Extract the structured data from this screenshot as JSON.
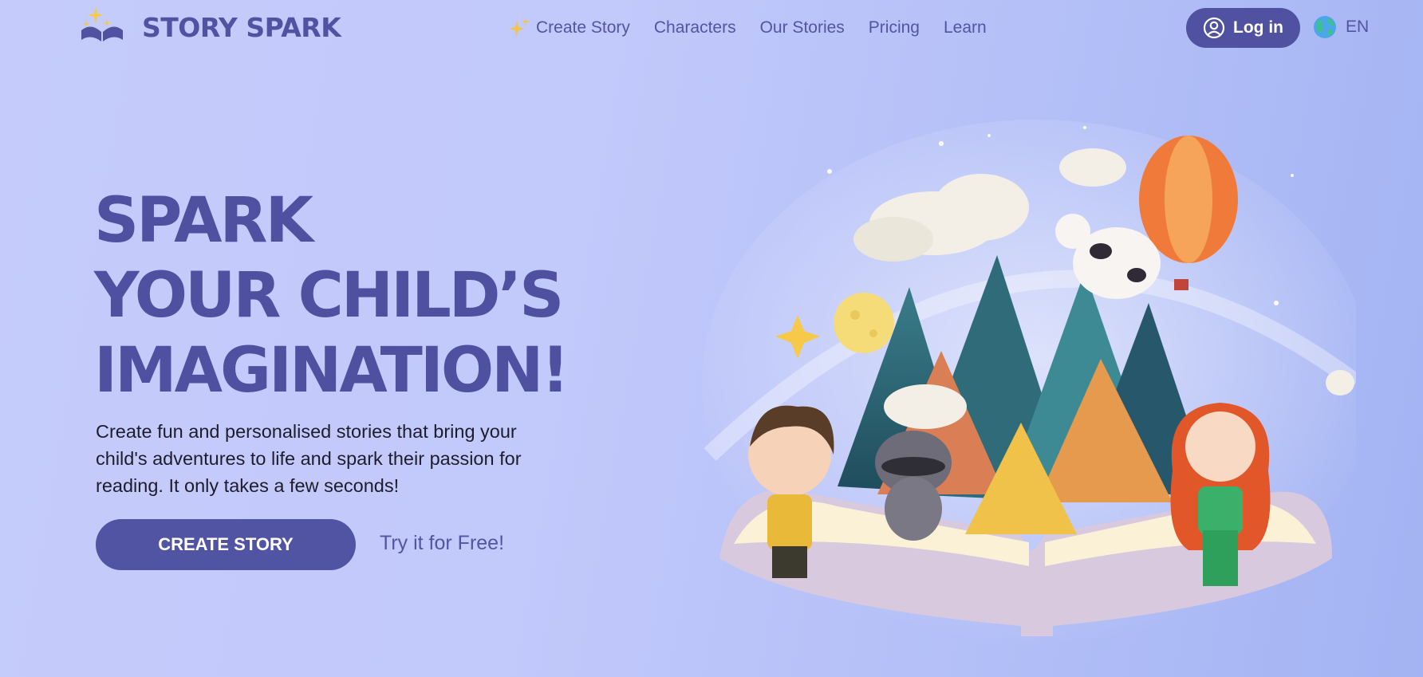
{
  "brand": {
    "name": "STORY SPARK",
    "logo": "open-book-sparkle-logo"
  },
  "nav": {
    "items": [
      {
        "label": "Create Story",
        "icon": "sparkles-icon"
      },
      {
        "label": "Characters"
      },
      {
        "label": "Our Stories"
      },
      {
        "label": "Pricing"
      },
      {
        "label": "Learn"
      }
    ]
  },
  "header": {
    "login_label": "Log in",
    "login_icon": "user-circle-icon",
    "language": "EN",
    "language_icon": "globe-icon"
  },
  "hero": {
    "title_lines": [
      "SPARK",
      "YOUR CHILD’S",
      "IMAGINATION!"
    ],
    "description_lines": [
      "Create fun and personalised stories that bring your",
      "child's adventures to life and spark their passion for",
      "reading. It only takes a few seconds!"
    ],
    "cta_label": "CREATE STORY",
    "secondary_link": "Try it for Free!"
  },
  "colors": {
    "primary": "#5052a1",
    "background": "#c2c9fb",
    "text_dark": "#1d1d2c"
  }
}
